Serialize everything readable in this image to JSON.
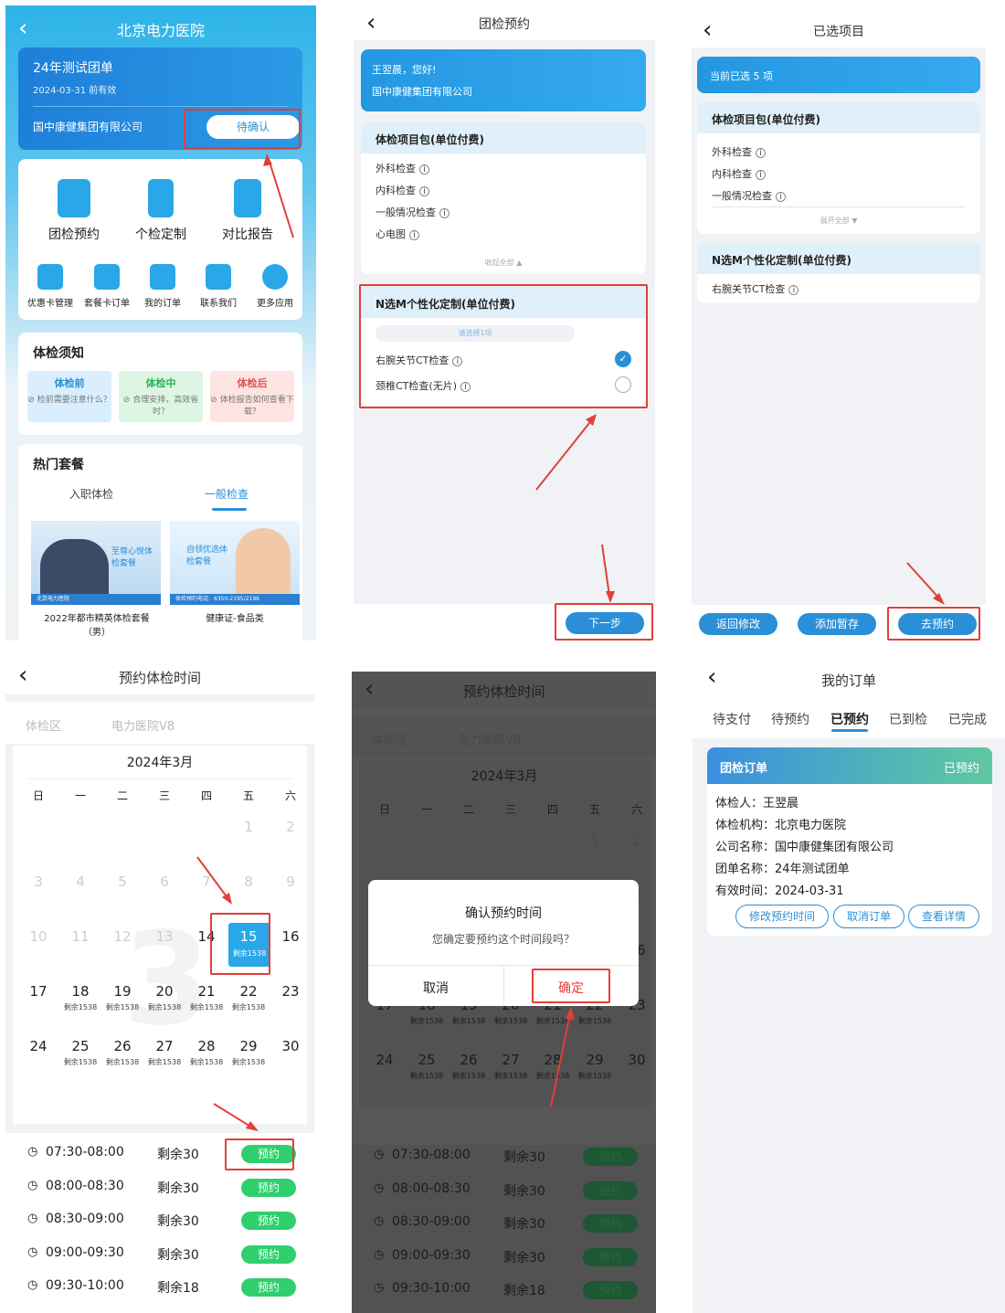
{
  "s1": {
    "title": "北京电力医院",
    "order_title": "24年测试团单",
    "valid": "2024-03-31 前有效",
    "company": "国中康健集团有限公司",
    "status_btn": "待确认",
    "services": [
      "团检预约",
      "个检定制",
      "对比报告"
    ],
    "services2": [
      "优惠卡管理",
      "套餐卡订单",
      "我的订单",
      "联系我们",
      "更多应用"
    ],
    "notice_title": "体检须知",
    "notices": [
      {
        "head": "体检前",
        "text": "⊘ 检前需要注意什么？"
      },
      {
        "head": "体检中",
        "text": "⊘ 合理安排，高效省时？"
      },
      {
        "head": "体检后",
        "text": "⊘ 体检报告如何查看下载？"
      }
    ],
    "hot_title": "热门套餐",
    "hot_tabs": [
      "入职体检",
      "一般检查"
    ],
    "pkg1": {
      "banner": "至尊心悦体检套餐",
      "footer": "北京电力医院",
      "name": "2022年都市精英体检套餐（男）"
    },
    "pkg2": {
      "banner": "自领优选体检套餐",
      "footer": "体检预约电话：6350-2195/2196",
      "name": "健康证-食品类"
    }
  },
  "s2": {
    "title": "团检预约",
    "greet": "王翌晨，您好!",
    "company": "国中康健集团有限公司",
    "pack_title": "体检项目包(单位付费)",
    "pack_items": [
      "外科检查",
      "内科检查",
      "一般情况检查",
      "心电图"
    ],
    "collapse": "收起全部",
    "nm_title": "N选M个性化定制(单位付费)",
    "nm_hint": "请选择1项",
    "nm_items": [
      "右腕关节CT检查",
      "颈椎CT检查(无片)"
    ],
    "next": "下一步"
  },
  "s3": {
    "title": "已选项目",
    "count": "当前已选 5 项",
    "pack_title": "体检项目包(单位付费)",
    "pack_items": [
      "外科检查",
      "内科检查",
      "一般情况检查"
    ],
    "expand": "展开全部",
    "nm_title": "N选M个性化定制(单位付费)",
    "nm_items": [
      "右腕关节CT检查"
    ],
    "buttons": [
      "返回修改",
      "添加暂存",
      "去预约"
    ]
  },
  "s4": {
    "title": "预约体检时间",
    "area_label": "体检区",
    "area_value": "电力医院V8",
    "month": "2024年3月",
    "weekdays": [
      "日",
      "一",
      "二",
      "三",
      "四",
      "五",
      "六"
    ],
    "weeks": [
      [
        "",
        "",
        "",
        "",
        "",
        "1",
        "2"
      ],
      [
        "3",
        "4",
        "5",
        "6",
        "7",
        "8",
        "9"
      ],
      [
        "10",
        "11",
        "12",
        "13",
        "14",
        "15",
        "16"
      ],
      [
        "17",
        "18",
        "19",
        "20",
        "21",
        "22",
        "23"
      ],
      [
        "24",
        "25",
        "26",
        "27",
        "28",
        "29",
        "30"
      ]
    ],
    "selected_remain": "剩余1538",
    "remain": "剩余1538",
    "watermark": "3",
    "slots": [
      {
        "time": "07:30-08:00",
        "left": "剩余30"
      },
      {
        "time": "08:00-08:30",
        "left": "剩余30"
      },
      {
        "time": "08:30-09:00",
        "left": "剩余30"
      },
      {
        "time": "09:00-09:30",
        "left": "剩余30"
      },
      {
        "time": "09:30-10:00",
        "left": "剩余18"
      }
    ],
    "book": "预约"
  },
  "s5": {
    "title": "预约体检时间",
    "dialog_title": "确认预约时间",
    "dialog_msg": "您确定要预约这个时间段吗？",
    "cancel": "取消",
    "ok": "确定"
  },
  "s6": {
    "title": "我的订单",
    "tabs": [
      "待支付",
      "待预约",
      "已预约",
      "已到检",
      "已完成"
    ],
    "card_title": "团检订单",
    "card_status": "已预约",
    "lines": [
      "体检人：王翌晨",
      "体检机构：北京电力医院",
      "公司名称：国中康健集团有限公司",
      "团单名称：24年测试团单",
      "有效时间：2024-03-31"
    ],
    "btns": [
      "修改预约时间",
      "取消订单",
      "查看详情"
    ]
  },
  "colors": {
    "primary": "#2aa7e8",
    "green": "#2fcf6d",
    "red": "#e0403a"
  }
}
